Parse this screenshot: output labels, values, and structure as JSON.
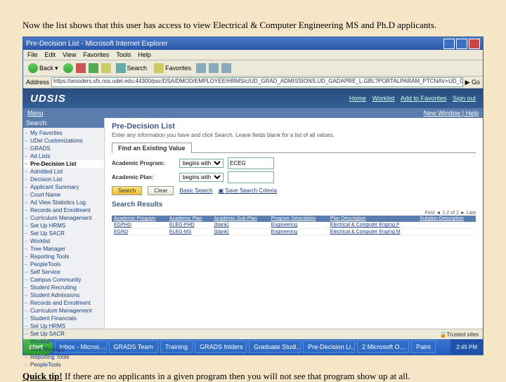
{
  "caption_top": "Now the list shows that this user has access to view Electrical & Computer Engineering MS and Ph.D applicants.",
  "caption_bottom_q": "Quick tip!",
  "caption_bottom_rest": "  If there are no applicants in a given program then you will not see that program show up at all.",
  "title": "Pre-Decision List - Microsoft Internet Explorer",
  "menu": {
    "file": "File",
    "edit": "Edit",
    "view": "View",
    "favorites": "Favorites",
    "tools": "Tools",
    "help": "Help"
  },
  "tb": {
    "back": "Back",
    "search": "Search",
    "fav": "Favorites"
  },
  "address_label": "Address",
  "address_url": "https://wooders.sfs.nss.udel.edu:44300/psc/DSAIDMOD/EMPLOYEE/HRMS/c/UD_GRAD_ADMISSIONS.UD_GADAPRE_L.GBL?PORTALPARAM_PTCNAV=UD_GADAPRE_L_GBL&EOPP.SCNode=HRMS&EOPP.SCPortal=EMP",
  "go": "Go",
  "logo": "UDSIS",
  "hlinks": {
    "home": "Home",
    "worklist": "Worklist",
    "add": "Add to Favorites",
    "signout": "Sign out"
  },
  "toplinks": {
    "newwin": "New Window",
    "help": "Help"
  },
  "side": {
    "menu": "Menu",
    "search": "Search:",
    "items": [
      "My Favorites",
      "UDel Customizations",
      "GRADS",
      "  Ad Lists",
      "    Pre-Decision List",
      "    Admitted List",
      "    Decision List",
      "    Applicant Summary",
      "    Court Name",
      "    Ad View Statistics Log",
      "Records and Enrollment",
      "Curriculum Management",
      "Set Up HRMS",
      "Set Up SACR",
      "Worklist",
      "Tree Manager",
      "Reporting Tools",
      "PeopleTools"
    ],
    "items2": [
      "Self Service",
      "Campus Community",
      "Student Recruiting",
      "Student Admissions",
      "Records and Enrollment",
      "Curriculum Management",
      "Student Financials",
      "Set Up HRMS",
      "Set Up SACR",
      "Worklist",
      "Tree Manager",
      "Reporting Tools",
      "PeopleTools"
    ]
  },
  "page": {
    "title": "Pre-Decision List",
    "desc": "Enter any information you have and click Search. Leave fields blank for a list of all values.",
    "tab": "Find an Existing Value"
  },
  "form": {
    "acad_label": "Academic Program:",
    "plan_label": "Academic Plan:",
    "op": "begins with",
    "val": "ECEG"
  },
  "buttons": {
    "search": "Search",
    "clear": "Clear",
    "basic": "Basic Search",
    "save": "Save Search Criteria"
  },
  "results": {
    "head": "Search Results",
    "pager": "First  ◄  1-2 of 2  ►  Last",
    "cols": [
      "Academic Program",
      "Academic Plan",
      "Academic Sub-Plan",
      "Program Description",
      "Plan Description",
      "Subplan Description"
    ],
    "rows": [
      [
        "EGPHD",
        "ELEG-PHD",
        "(blank)",
        "Engineering",
        "Electrical & Computer Engrng P",
        ""
      ],
      [
        "EGRD",
        "ELEG-MS",
        "(blank)",
        "Engineering",
        "Electrical & Computer Engrng M",
        ""
      ]
    ]
  },
  "status": "Trusted sites",
  "taskbar": {
    "start": "start",
    "items": [
      "Inbox - Micros…",
      "GRADS Team",
      "Training",
      "GRADS folders",
      "Graduate Studi…",
      "Pre-Decision Li…",
      "2 Microsoft O…",
      "Paint"
    ],
    "time": "2:45 PM"
  }
}
